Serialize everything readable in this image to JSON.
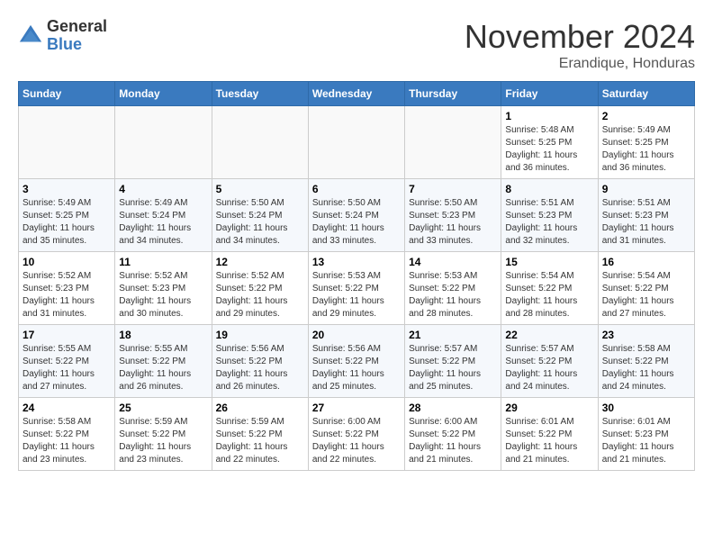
{
  "header": {
    "logo_line1": "General",
    "logo_line2": "Blue",
    "month": "November 2024",
    "location": "Erandique, Honduras"
  },
  "weekdays": [
    "Sunday",
    "Monday",
    "Tuesday",
    "Wednesday",
    "Thursday",
    "Friday",
    "Saturday"
  ],
  "weeks": [
    [
      {
        "day": "",
        "info": ""
      },
      {
        "day": "",
        "info": ""
      },
      {
        "day": "",
        "info": ""
      },
      {
        "day": "",
        "info": ""
      },
      {
        "day": "",
        "info": ""
      },
      {
        "day": "1",
        "info": "Sunrise: 5:48 AM\nSunset: 5:25 PM\nDaylight: 11 hours\nand 36 minutes."
      },
      {
        "day": "2",
        "info": "Sunrise: 5:49 AM\nSunset: 5:25 PM\nDaylight: 11 hours\nand 36 minutes."
      }
    ],
    [
      {
        "day": "3",
        "info": "Sunrise: 5:49 AM\nSunset: 5:25 PM\nDaylight: 11 hours\nand 35 minutes."
      },
      {
        "day": "4",
        "info": "Sunrise: 5:49 AM\nSunset: 5:24 PM\nDaylight: 11 hours\nand 34 minutes."
      },
      {
        "day": "5",
        "info": "Sunrise: 5:50 AM\nSunset: 5:24 PM\nDaylight: 11 hours\nand 34 minutes."
      },
      {
        "day": "6",
        "info": "Sunrise: 5:50 AM\nSunset: 5:24 PM\nDaylight: 11 hours\nand 33 minutes."
      },
      {
        "day": "7",
        "info": "Sunrise: 5:50 AM\nSunset: 5:23 PM\nDaylight: 11 hours\nand 33 minutes."
      },
      {
        "day": "8",
        "info": "Sunrise: 5:51 AM\nSunset: 5:23 PM\nDaylight: 11 hours\nand 32 minutes."
      },
      {
        "day": "9",
        "info": "Sunrise: 5:51 AM\nSunset: 5:23 PM\nDaylight: 11 hours\nand 31 minutes."
      }
    ],
    [
      {
        "day": "10",
        "info": "Sunrise: 5:52 AM\nSunset: 5:23 PM\nDaylight: 11 hours\nand 31 minutes."
      },
      {
        "day": "11",
        "info": "Sunrise: 5:52 AM\nSunset: 5:23 PM\nDaylight: 11 hours\nand 30 minutes."
      },
      {
        "day": "12",
        "info": "Sunrise: 5:52 AM\nSunset: 5:22 PM\nDaylight: 11 hours\nand 29 minutes."
      },
      {
        "day": "13",
        "info": "Sunrise: 5:53 AM\nSunset: 5:22 PM\nDaylight: 11 hours\nand 29 minutes."
      },
      {
        "day": "14",
        "info": "Sunrise: 5:53 AM\nSunset: 5:22 PM\nDaylight: 11 hours\nand 28 minutes."
      },
      {
        "day": "15",
        "info": "Sunrise: 5:54 AM\nSunset: 5:22 PM\nDaylight: 11 hours\nand 28 minutes."
      },
      {
        "day": "16",
        "info": "Sunrise: 5:54 AM\nSunset: 5:22 PM\nDaylight: 11 hours\nand 27 minutes."
      }
    ],
    [
      {
        "day": "17",
        "info": "Sunrise: 5:55 AM\nSunset: 5:22 PM\nDaylight: 11 hours\nand 27 minutes."
      },
      {
        "day": "18",
        "info": "Sunrise: 5:55 AM\nSunset: 5:22 PM\nDaylight: 11 hours\nand 26 minutes."
      },
      {
        "day": "19",
        "info": "Sunrise: 5:56 AM\nSunset: 5:22 PM\nDaylight: 11 hours\nand 26 minutes."
      },
      {
        "day": "20",
        "info": "Sunrise: 5:56 AM\nSunset: 5:22 PM\nDaylight: 11 hours\nand 25 minutes."
      },
      {
        "day": "21",
        "info": "Sunrise: 5:57 AM\nSunset: 5:22 PM\nDaylight: 11 hours\nand 25 minutes."
      },
      {
        "day": "22",
        "info": "Sunrise: 5:57 AM\nSunset: 5:22 PM\nDaylight: 11 hours\nand 24 minutes."
      },
      {
        "day": "23",
        "info": "Sunrise: 5:58 AM\nSunset: 5:22 PM\nDaylight: 11 hours\nand 24 minutes."
      }
    ],
    [
      {
        "day": "24",
        "info": "Sunrise: 5:58 AM\nSunset: 5:22 PM\nDaylight: 11 hours\nand 23 minutes."
      },
      {
        "day": "25",
        "info": "Sunrise: 5:59 AM\nSunset: 5:22 PM\nDaylight: 11 hours\nand 23 minutes."
      },
      {
        "day": "26",
        "info": "Sunrise: 5:59 AM\nSunset: 5:22 PM\nDaylight: 11 hours\nand 22 minutes."
      },
      {
        "day": "27",
        "info": "Sunrise: 6:00 AM\nSunset: 5:22 PM\nDaylight: 11 hours\nand 22 minutes."
      },
      {
        "day": "28",
        "info": "Sunrise: 6:00 AM\nSunset: 5:22 PM\nDaylight: 11 hours\nand 21 minutes."
      },
      {
        "day": "29",
        "info": "Sunrise: 6:01 AM\nSunset: 5:22 PM\nDaylight: 11 hours\nand 21 minutes."
      },
      {
        "day": "30",
        "info": "Sunrise: 6:01 AM\nSunset: 5:23 PM\nDaylight: 11 hours\nand 21 minutes."
      }
    ]
  ]
}
